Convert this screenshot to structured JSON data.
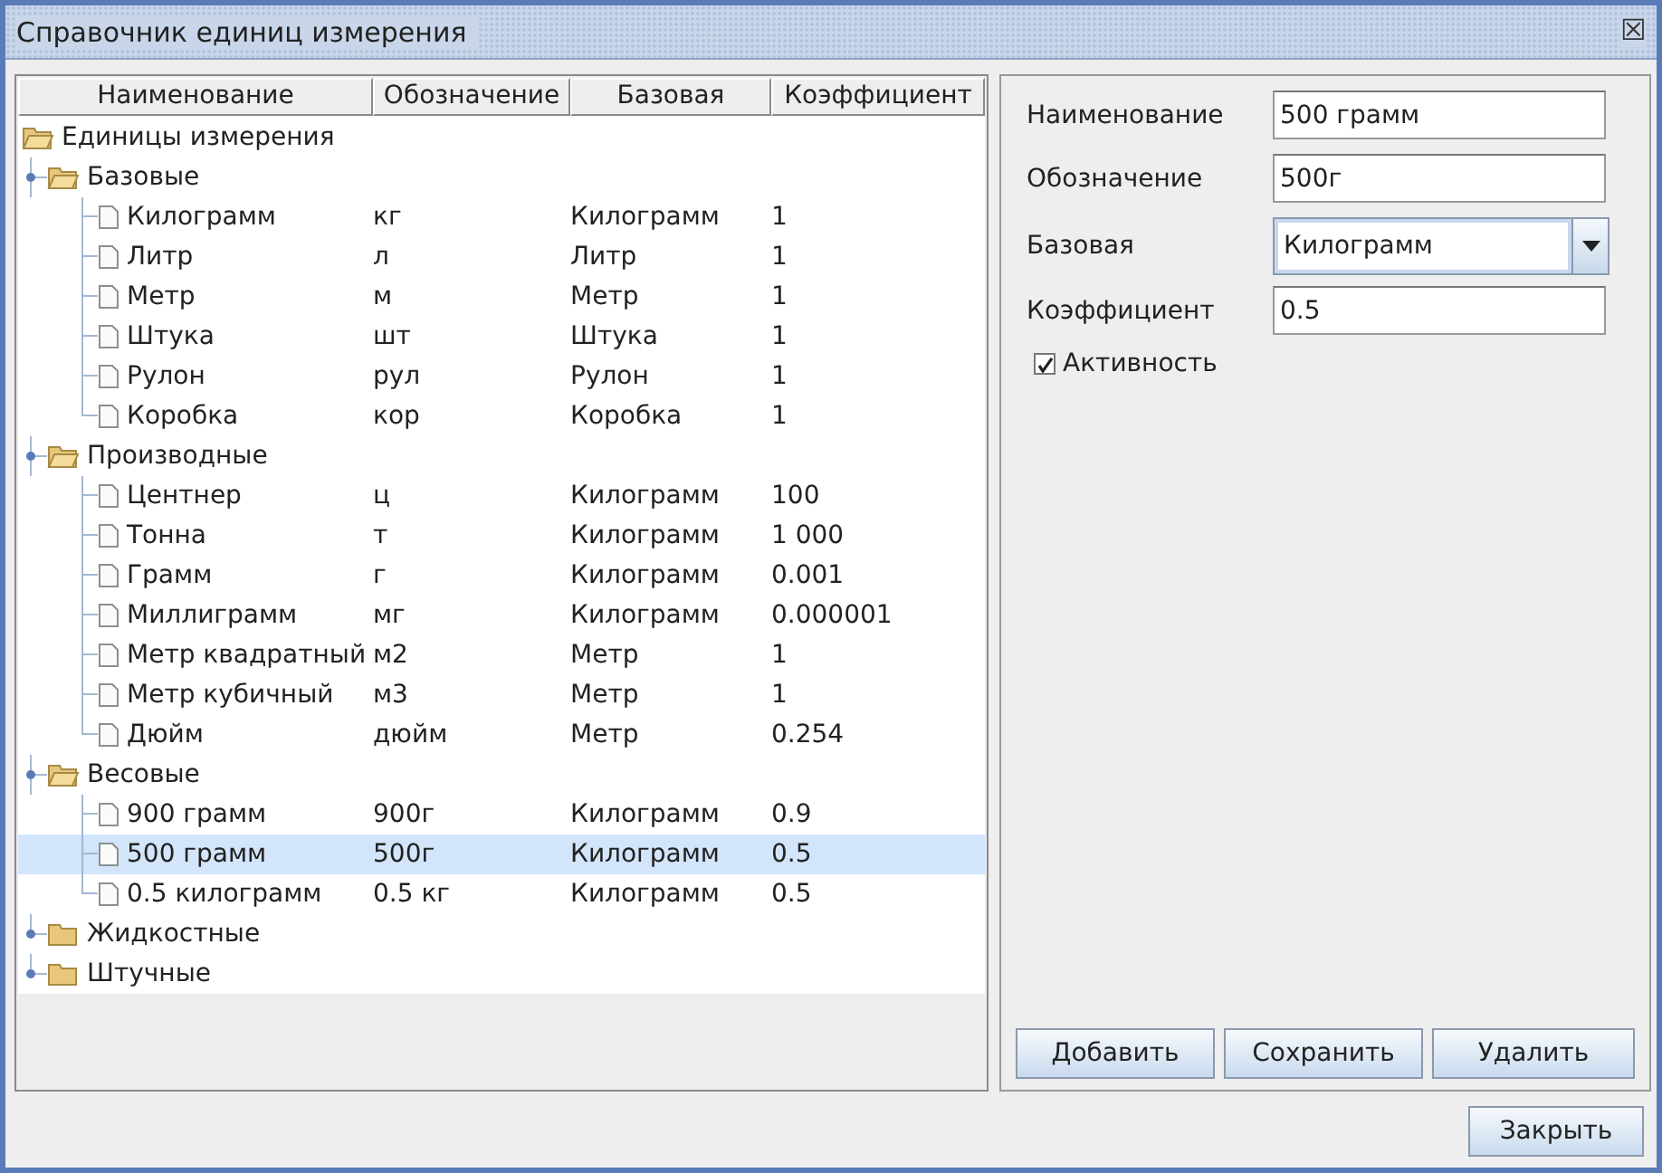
{
  "window": {
    "title": "Справочник единиц измерения",
    "close": "☒"
  },
  "table": {
    "columns": [
      "Наименование",
      "Обозначение",
      "Базовая",
      "Коэффициент"
    ],
    "tree": {
      "name": "Единицы измерения",
      "expanded": true,
      "children": [
        {
          "name": "Базовые",
          "expanded": true,
          "children": [
            {
              "name": "Килограмм",
              "symbol": "кг",
              "base": "Килограмм",
              "coef": "1",
              "selected": false
            },
            {
              "name": "Литр",
              "symbol": "л",
              "base": "Литр",
              "coef": "1",
              "selected": false
            },
            {
              "name": "Метр",
              "symbol": "м",
              "base": "Метр",
              "coef": "1",
              "selected": false
            },
            {
              "name": "Штука",
              "symbol": "шт",
              "base": "Штука",
              "coef": "1",
              "selected": false
            },
            {
              "name": "Рулон",
              "symbol": "рул",
              "base": "Рулон",
              "coef": "1",
              "selected": false
            },
            {
              "name": "Коробка",
              "symbol": "кор",
              "base": "Коробка",
              "coef": "1",
              "selected": false
            }
          ]
        },
        {
          "name": "Производные",
          "expanded": true,
          "children": [
            {
              "name": "Центнер",
              "symbol": "ц",
              "base": "Килограмм",
              "coef": "100",
              "selected": false
            },
            {
              "name": "Тонна",
              "symbol": "т",
              "base": "Килограмм",
              "coef": "1 000",
              "selected": false
            },
            {
              "name": "Грамм",
              "symbol": "г",
              "base": "Килограмм",
              "coef": "0.001",
              "selected": false
            },
            {
              "name": "Миллиграмм",
              "symbol": "мг",
              "base": "Килограмм",
              "coef": "0.000001",
              "selected": false
            },
            {
              "name": "Метр квадратный",
              "symbol": "м2",
              "base": "Метр",
              "coef": "1",
              "selected": false
            },
            {
              "name": "Метр кубичный",
              "symbol": "м3",
              "base": "Метр",
              "coef": "1",
              "selected": false
            },
            {
              "name": "Дюйм",
              "symbol": "дюйм",
              "base": "Метр",
              "coef": "0.254",
              "selected": false
            }
          ]
        },
        {
          "name": "Весовые",
          "expanded": true,
          "children": [
            {
              "name": "900 грамм",
              "symbol": "900г",
              "base": "Килограмм",
              "coef": "0.9",
              "selected": false
            },
            {
              "name": "500 грамм",
              "symbol": "500г",
              "base": "Килограмм",
              "coef": "0.5",
              "selected": true
            },
            {
              "name": "0.5 килограмм",
              "symbol": "0.5 кг",
              "base": "Килограмм",
              "coef": "0.5",
              "selected": false
            }
          ]
        },
        {
          "name": "Жидкостные",
          "expanded": false
        },
        {
          "name": "Штучные",
          "expanded": false
        }
      ]
    }
  },
  "form": {
    "fields": [
      {
        "kind": "text",
        "label": "Наименование",
        "value": "500 грамм"
      },
      {
        "kind": "text",
        "label": "Обозначение",
        "value": "500г"
      },
      {
        "kind": "combo",
        "label": "Базовая",
        "value": "Килограмм"
      },
      {
        "kind": "text",
        "label": "Коэффициент",
        "value": "0.5"
      }
    ],
    "active": {
      "label": "Активность",
      "checked": true
    },
    "buttons": [
      "Добавить",
      "Сохранить",
      "Удалить"
    ]
  },
  "footer_buttons": [
    "Закрыть"
  ]
}
